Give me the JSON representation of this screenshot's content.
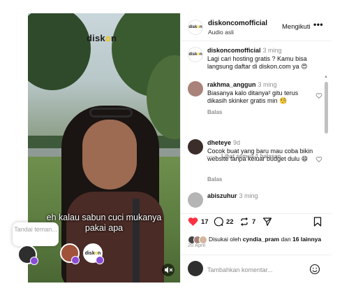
{
  "media": {
    "logo_prefix": "disk",
    "logo_o": "o",
    "logo_suffix": "n",
    "caption_line1": "eh kalau sabun cuci mukanya",
    "caption_line2": "pakai apa",
    "mute_icon": "speaker-muted-icon"
  },
  "tag_overlay": {
    "prompt": "Tandai teman..."
  },
  "header": {
    "username": "diskoncomofficial",
    "audio": "Audio asli",
    "follow_label": "Mengikuti",
    "more_label": "•••",
    "logo_text": "diskon"
  },
  "comments": [
    {
      "user": "diskoncomofficial",
      "time": "3 ming",
      "text": "Lagi cari hosting gratis ? Kamu bisa langsung daftar di diskon.com ya 😍"
    },
    {
      "user": "rakhma_anggun",
      "time": "3 ming",
      "text": "Biasanya kalo ditanya² gitu terus dikasih skinker gratis min 🧐",
      "reply_label": "Balas"
    },
    {
      "view_replies": "Lihat semua 1 balasan"
    },
    {
      "user": "dheteye",
      "time": "9d",
      "text": "Cocok buat yang baru mau coba bikin website tanpa keluar budget dulu 😄",
      "reply_label": "Balas"
    },
    {
      "user": "abiszuhur",
      "time": "3 ming"
    }
  ],
  "actions": {
    "likes": "17",
    "comments": "22",
    "reposts": "7"
  },
  "liked_by": {
    "prefix": "Disukai oleh ",
    "user": "cyndia_pram",
    "middle": " dan ",
    "others": "16 lainnya"
  },
  "date": "20 April",
  "comment_input": {
    "placeholder": "Tambahkan komentar..."
  },
  "colors": {
    "like_red": "#ff3040",
    "tag_purple": "#8a4cd6",
    "logo_yellow": "#f2c200"
  }
}
